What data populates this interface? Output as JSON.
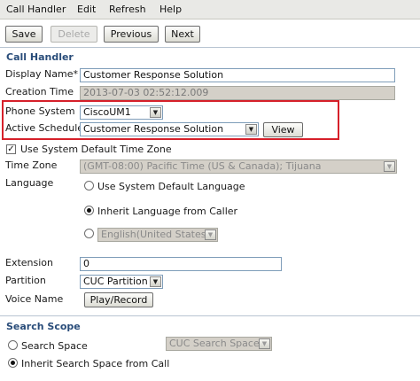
{
  "menu": [
    "Call Handler",
    "Edit",
    "Refresh",
    "Help"
  ],
  "toolbar": {
    "save": "Save",
    "delete": "Delete",
    "previous": "Previous",
    "next": "Next"
  },
  "section_call_handler": "Call Handler",
  "fields": {
    "display_name": {
      "label": "Display Name*",
      "value": "Customer Response Solution"
    },
    "creation_time": {
      "label": "Creation Time",
      "value": "2013-07-03 02:52:12.009"
    },
    "phone_system": {
      "label": "Phone System",
      "value": "CiscoUM1"
    },
    "active_schedule": {
      "label": "Active Schedule",
      "value": "Customer Response Solution",
      "view_button": "View"
    },
    "use_system_tz": {
      "label": "Use System Default Time Zone",
      "checked": true
    },
    "time_zone": {
      "label": "Time Zone",
      "value": "(GMT-08:00) Pacific Time (US & Canada); Tijuana"
    },
    "language": {
      "label": "Language",
      "options": [
        "Use System Default Language",
        "Inherit Language from Caller"
      ],
      "selected": "Inherit Language from Caller",
      "custom_value": "English(United States)"
    },
    "extension": {
      "label": "Extension",
      "value": "0"
    },
    "partition": {
      "label": "Partition",
      "value": "CUC Partition"
    },
    "voice_name": {
      "label": "Voice Name",
      "button": "Play/Record"
    }
  },
  "section_search_scope": "Search Scope",
  "search_scope": {
    "search_space_label": "Search Space",
    "search_space_value": "CUC Search Space",
    "inherit_label": "Inherit Search Space from Call",
    "selected": "inherit"
  },
  "colors": {
    "highlight": "#d6202a",
    "section_title": "#2a4d7a"
  }
}
